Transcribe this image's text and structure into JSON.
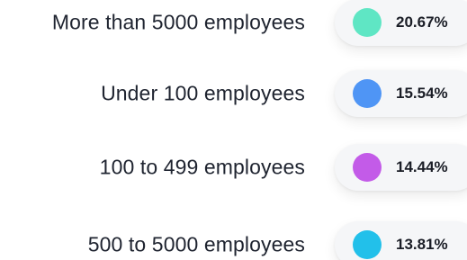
{
  "legend": {
    "items": [
      {
        "label": "More than 5000 employees",
        "percent": "20.67%",
        "color": "#5fe6c4"
      },
      {
        "label": "Under 100 employees",
        "percent": "15.54%",
        "color": "#4f95f5"
      },
      {
        "label": "100 to 499 employees",
        "percent": "14.44%",
        "color": "#c35be8"
      },
      {
        "label": "500 to 5000 employees",
        "percent": "13.81%",
        "color": "#22c0ea"
      }
    ]
  }
}
